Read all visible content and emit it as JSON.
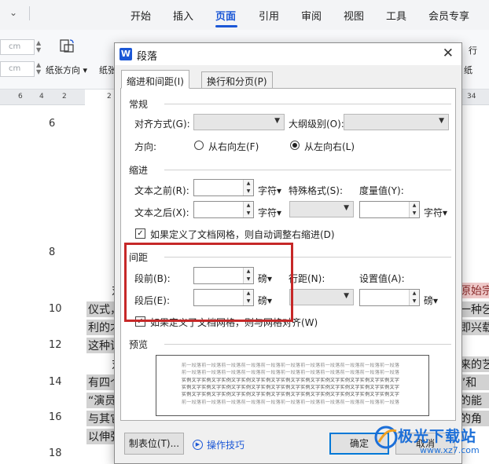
{
  "ribbon": {
    "tabs": [
      "开始",
      "插入",
      "页面",
      "引用",
      "审阅",
      "视图",
      "工具",
      "会员专享"
    ],
    "active_tab": "页面",
    "unit_cm": "cm",
    "paper_orientation": "纸张方向",
    "paper_size_partial": "纸张",
    "right_partial_top": "行",
    "right_partial_bottom": "纸"
  },
  "ruler": {
    "numbers": [
      "6",
      "4",
      "2",
      "2",
      "34"
    ]
  },
  "document": {
    "line_numbers": [
      "6",
      "8",
      "10",
      "12",
      "14",
      "16",
      "18"
    ],
    "left_fragments": [
      "对",
      "仪式，",
      "利的才",
      "这种讨",
      "对",
      "有四个",
      "“演员",
      "与其它",
      "以伸张"
    ],
    "right_fragments": [
      "原始宗",
      "一种乞",
      "即兴载",
      "",
      "来的艺",
      "”和",
      "的能",
      "的角",
      ""
    ]
  },
  "dialog": {
    "title": "段落",
    "app_icon": "W",
    "tabs": [
      "缩进和间距(I)",
      "换行和分页(P)"
    ],
    "general": {
      "section": "常规",
      "alignment_label": "对齐方式(G):",
      "alignment_value": "",
      "outline_label": "大纲级别(O):",
      "outline_value": "",
      "direction_label": "方向:",
      "rtl_label": "从右向左(F)",
      "ltr_label": "从左向右(L)",
      "selected_direction": "ltr"
    },
    "indent": {
      "section": "缩进",
      "before_label": "文本之前(R):",
      "before_value": "",
      "before_unit": "字符",
      "after_label": "文本之后(X):",
      "after_value": "",
      "after_unit": "字符",
      "special_label": "特殊格式(S):",
      "special_value": "",
      "measure_label": "度量值(Y):",
      "measure_value": "",
      "measure_unit": "字符",
      "auto_adjust_label": "如果定义了文档网格，则自动调整右缩进(D)",
      "auto_adjust_checked": true
    },
    "spacing": {
      "section": "间距",
      "before_label": "段前(B):",
      "before_value": "",
      "before_unit": "磅",
      "after_label": "段后(E):",
      "after_value": "",
      "after_unit": "磅",
      "line_label": "行距(N):",
      "line_value": "",
      "setting_label": "设置值(A):",
      "setting_value": "",
      "setting_unit": "磅",
      "grid_align_label": "如果定义了文档网格，则与网格对齐(W)",
      "grid_align_checked": true
    },
    "preview": {
      "section": "预览",
      "prev_text": "前一段落前一段落前一段落前一段落前一段落前一段落前一段落前一段落前一段落前一段落前一段落",
      "sample_text": "实例文字实例文字实例文字实例文字实例文字实例文字实例文字实例文字实例文字实例文字实例文字"
    },
    "buttons": {
      "tabs_button": "制表位(T)...",
      "tips_link": "操作技巧",
      "ok": "确定",
      "cancel": "取消"
    }
  },
  "watermark": {
    "name": "极光下载站",
    "url": "www.xz7.com"
  },
  "colors": {
    "accent": "#1b57d6",
    "highlight": "#c62828",
    "ok_border": "#0078d7"
  }
}
